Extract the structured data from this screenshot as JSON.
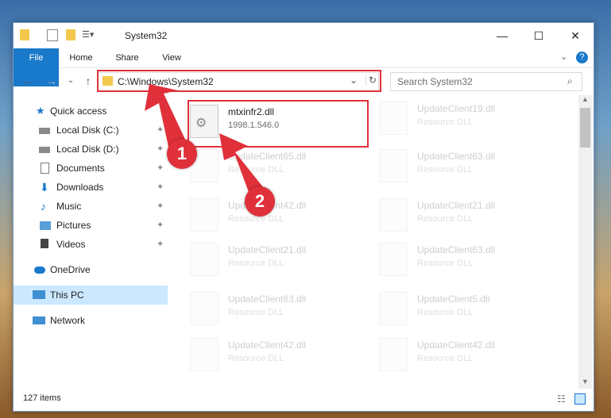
{
  "window": {
    "title": "System32"
  },
  "ribbon": {
    "tabs": [
      "File",
      "Home",
      "Share",
      "View"
    ]
  },
  "address": {
    "path": "C:\\Windows\\System32",
    "search_placeholder": "Search System32"
  },
  "nav": {
    "items": [
      {
        "label": "Quick access",
        "icon": "star-icon",
        "pinned": false
      },
      {
        "label": "Local Disk (C:)",
        "icon": "drive-icon",
        "pinned": true
      },
      {
        "label": "Local Disk (D:)",
        "icon": "drive-icon",
        "pinned": true
      },
      {
        "label": "Documents",
        "icon": "document-icon",
        "pinned": true
      },
      {
        "label": "Downloads",
        "icon": "download-icon",
        "pinned": true
      },
      {
        "label": "Music",
        "icon": "music-icon",
        "pinned": true
      },
      {
        "label": "Pictures",
        "icon": "picture-icon",
        "pinned": true
      },
      {
        "label": "Videos",
        "icon": "video-icon",
        "pinned": true
      },
      {
        "label": "OneDrive",
        "icon": "cloud-icon",
        "pinned": false
      },
      {
        "label": "This PC",
        "icon": "computer-icon",
        "pinned": false,
        "selected": true
      },
      {
        "label": "Network",
        "icon": "network-icon",
        "pinned": false
      }
    ]
  },
  "files": {
    "left": [
      {
        "name": "mtxinfr2.dll",
        "desc": "1998.1.546.0"
      },
      {
        "name": "UpdateClient65.dll",
        "desc": "Resource DLL"
      },
      {
        "name": "UpdateClient42.dll",
        "desc": "Resource DLL"
      },
      {
        "name": "UpdateClient21.dll",
        "desc": "Resource DLL"
      },
      {
        "name": "UpdateClient63.dll",
        "desc": "Resource DLL"
      },
      {
        "name": "UpdateClient42.dll",
        "desc": "Resource DLL"
      }
    ],
    "right": [
      {
        "name": "UpdateClient19.dll",
        "desc": "Resource DLL"
      },
      {
        "name": "UpdateClient63.dll",
        "desc": "Resource DLL"
      },
      {
        "name": "UpdateClient21.dll",
        "desc": "Resource DLL"
      },
      {
        "name": "UpdateClient63.dll",
        "desc": "Resource DLL"
      },
      {
        "name": "UpdateClient5.dll",
        "desc": "Resource DLL"
      },
      {
        "name": "UpdateClient42.dll",
        "desc": "Resource DLL"
      }
    ]
  },
  "status": {
    "count": "127 items"
  },
  "annotations": {
    "badge1": "1",
    "badge2": "2",
    "color": "#e0303a"
  }
}
